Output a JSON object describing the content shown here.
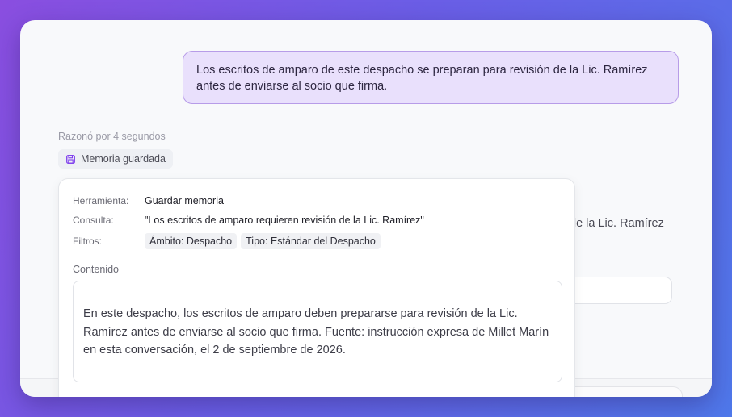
{
  "conversation": {
    "user_message": "Los escritos de amparo de este despacho se preparan para revisión de la Lic. Ramírez antes de enviarse al socio que firma.",
    "reasoning_note": "Razonó por 4 segundos",
    "memory_chip": {
      "label": "Memoria guardada",
      "icon": "save-icon"
    },
    "background_text": "de la Lic. Ramírez"
  },
  "tool_call": {
    "fields": [
      {
        "label": "Herramienta:",
        "value": "Guardar memoria"
      },
      {
        "label": "Consulta:",
        "value": "\"Los escritos de amparo requieren revisión de la Lic. Ramírez\""
      },
      {
        "label": "Filtros:",
        "tags": [
          "Ámbito: Despacho",
          "Tipo: Estándar del Despacho"
        ]
      }
    ],
    "content_label": "Contenido",
    "content": "En este despacho, los escritos de amparo deben prepararse para revisión de la Lic. Ramírez antes de enviarse al socio que firma. Fuente: instrucción expresa de Millet Marín en esta conversación, el 2 de septiembre de 2026."
  },
  "colors": {
    "accent": "#7c3aed",
    "bubble_bg": "#e9e0fc",
    "bubble_border": "#b79ce8"
  }
}
